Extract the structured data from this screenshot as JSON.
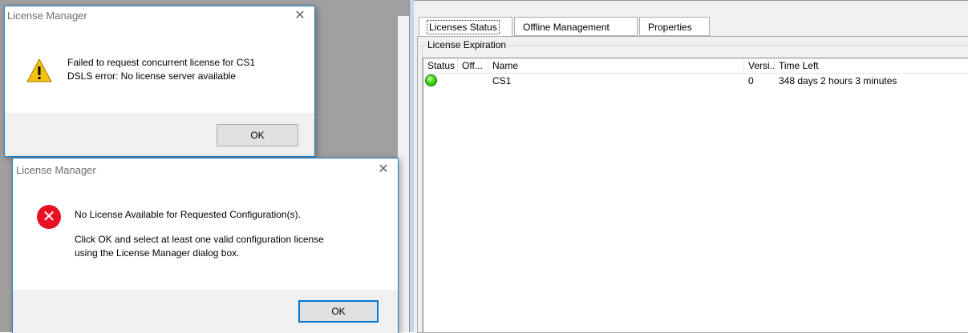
{
  "dialog1": {
    "title": "License Manager",
    "line1": "Failed to request concurrent license for CS1",
    "line2": "DSLS error: No license server available",
    "ok": "OK"
  },
  "dialog2": {
    "title": "License  Manager",
    "line1": "No License Available for Requested Configuration(s).",
    "line2": "Click OK and select at least one valid configuration license",
    "line3": "using the License Manager dialog box.",
    "ok": "OK"
  },
  "close_glyph": "✕",
  "tabs": [
    {
      "label": "Licenses Status"
    },
    {
      "label": "Offline Management"
    },
    {
      "label": "Properties"
    }
  ],
  "group_title": "License Expiration",
  "columns": [
    "Status",
    "Off...",
    "Name",
    "Versi...",
    "Time Left"
  ],
  "rows": [
    {
      "status": "green",
      "offline": "",
      "name": "CS1",
      "version": "0",
      "time_left": "348 days 2 hours 3 minutes"
    }
  ],
  "colors": {
    "status_ok": "#41d317",
    "error": "#e81123",
    "warning": "#f4c20d"
  }
}
